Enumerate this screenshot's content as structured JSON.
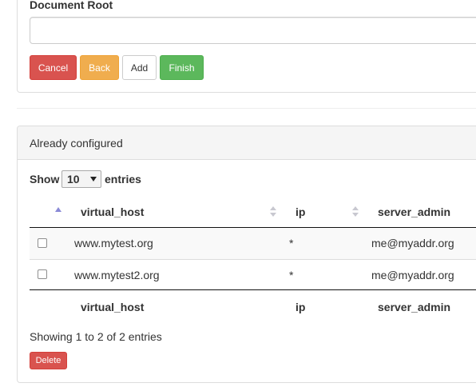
{
  "form": {
    "document_root_label": "Document Root",
    "document_root_value": "",
    "document_root_placeholder": ""
  },
  "buttons": {
    "cancel": "Cancel",
    "back": "Back",
    "add": "Add",
    "finish": "Finish",
    "delete": "Delete"
  },
  "configured_panel": {
    "title": "Already configured",
    "show_label": "Show",
    "page_length": "10",
    "entries_label": "entries",
    "columns": [
      "virtual_host",
      "ip",
      "server_admin"
    ],
    "rows": [
      {
        "virtual_host": "www.mytest.org",
        "ip": "*",
        "server_admin": "me@myaddr.org"
      },
      {
        "virtual_host": "www.mytest2.org",
        "ip": "*",
        "server_admin": "me@myaddr.org"
      }
    ],
    "footer_columns": [
      "virtual_host",
      "ip",
      "server_admin"
    ],
    "status": "Showing 1 to 2 of 2 entries"
  },
  "colors": {
    "danger": "#d9534f",
    "warning": "#f0ad4e",
    "success": "#5cb85c",
    "sort_active": "#8a8ad6"
  }
}
